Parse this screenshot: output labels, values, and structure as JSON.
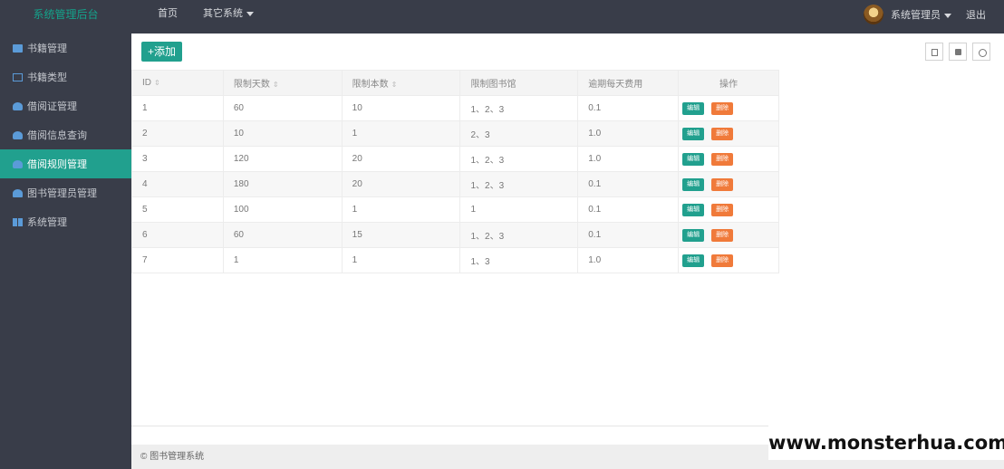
{
  "header": {
    "app_title": "系统管理后台",
    "nav": [
      {
        "label": "首页",
        "has_caret": false
      },
      {
        "label": "其它系统",
        "has_caret": true
      }
    ],
    "user_label": "系统管理员",
    "logout_label": "退出"
  },
  "sidebar": {
    "items": [
      {
        "label": "书籍管理",
        "icon": "book-icon",
        "active": false
      },
      {
        "label": "书籍类型",
        "icon": "list-icon",
        "active": false
      },
      {
        "label": "借阅证管理",
        "icon": "layers-icon",
        "active": false
      },
      {
        "label": "借阅信息查询",
        "icon": "layers-icon",
        "active": false
      },
      {
        "label": "借阅规则管理",
        "icon": "layers-icon",
        "active": true
      },
      {
        "label": "图书管理员管理",
        "icon": "users-icon",
        "active": false
      },
      {
        "label": "系统管理",
        "icon": "windows-icon",
        "active": false
      }
    ]
  },
  "toolbar": {
    "add_label": "+添加",
    "icons": [
      "columns-icon",
      "print-icon",
      "export-icon"
    ]
  },
  "table": {
    "columns": [
      "ID",
      "限制天数",
      "限制本数",
      "限制图书馆",
      "逾期每天费用",
      "操作"
    ],
    "sortable": [
      true,
      true,
      true,
      false,
      false,
      false
    ],
    "rows": [
      [
        "1",
        "60",
        "10",
        "1、2、3",
        "0.1"
      ],
      [
        "2",
        "10",
        "1",
        "2、3",
        "1.0"
      ],
      [
        "3",
        "120",
        "20",
        "1、2、3",
        "1.0"
      ],
      [
        "4",
        "180",
        "20",
        "1、2、3",
        "0.1"
      ],
      [
        "5",
        "100",
        "1",
        "1",
        "0.1"
      ],
      [
        "6",
        "60",
        "15",
        "1、2、3",
        "0.1"
      ],
      [
        "7",
        "1",
        "1",
        "1、3",
        "1.0"
      ]
    ],
    "edit_label": "编辑",
    "delete_label": "删除"
  },
  "footer": {
    "text": "© 图书管理系统"
  },
  "watermark": "www.monsterhua.com",
  "colors": {
    "topbar": "#393d49",
    "accent": "#21a08e",
    "danger": "#f07a3a"
  }
}
